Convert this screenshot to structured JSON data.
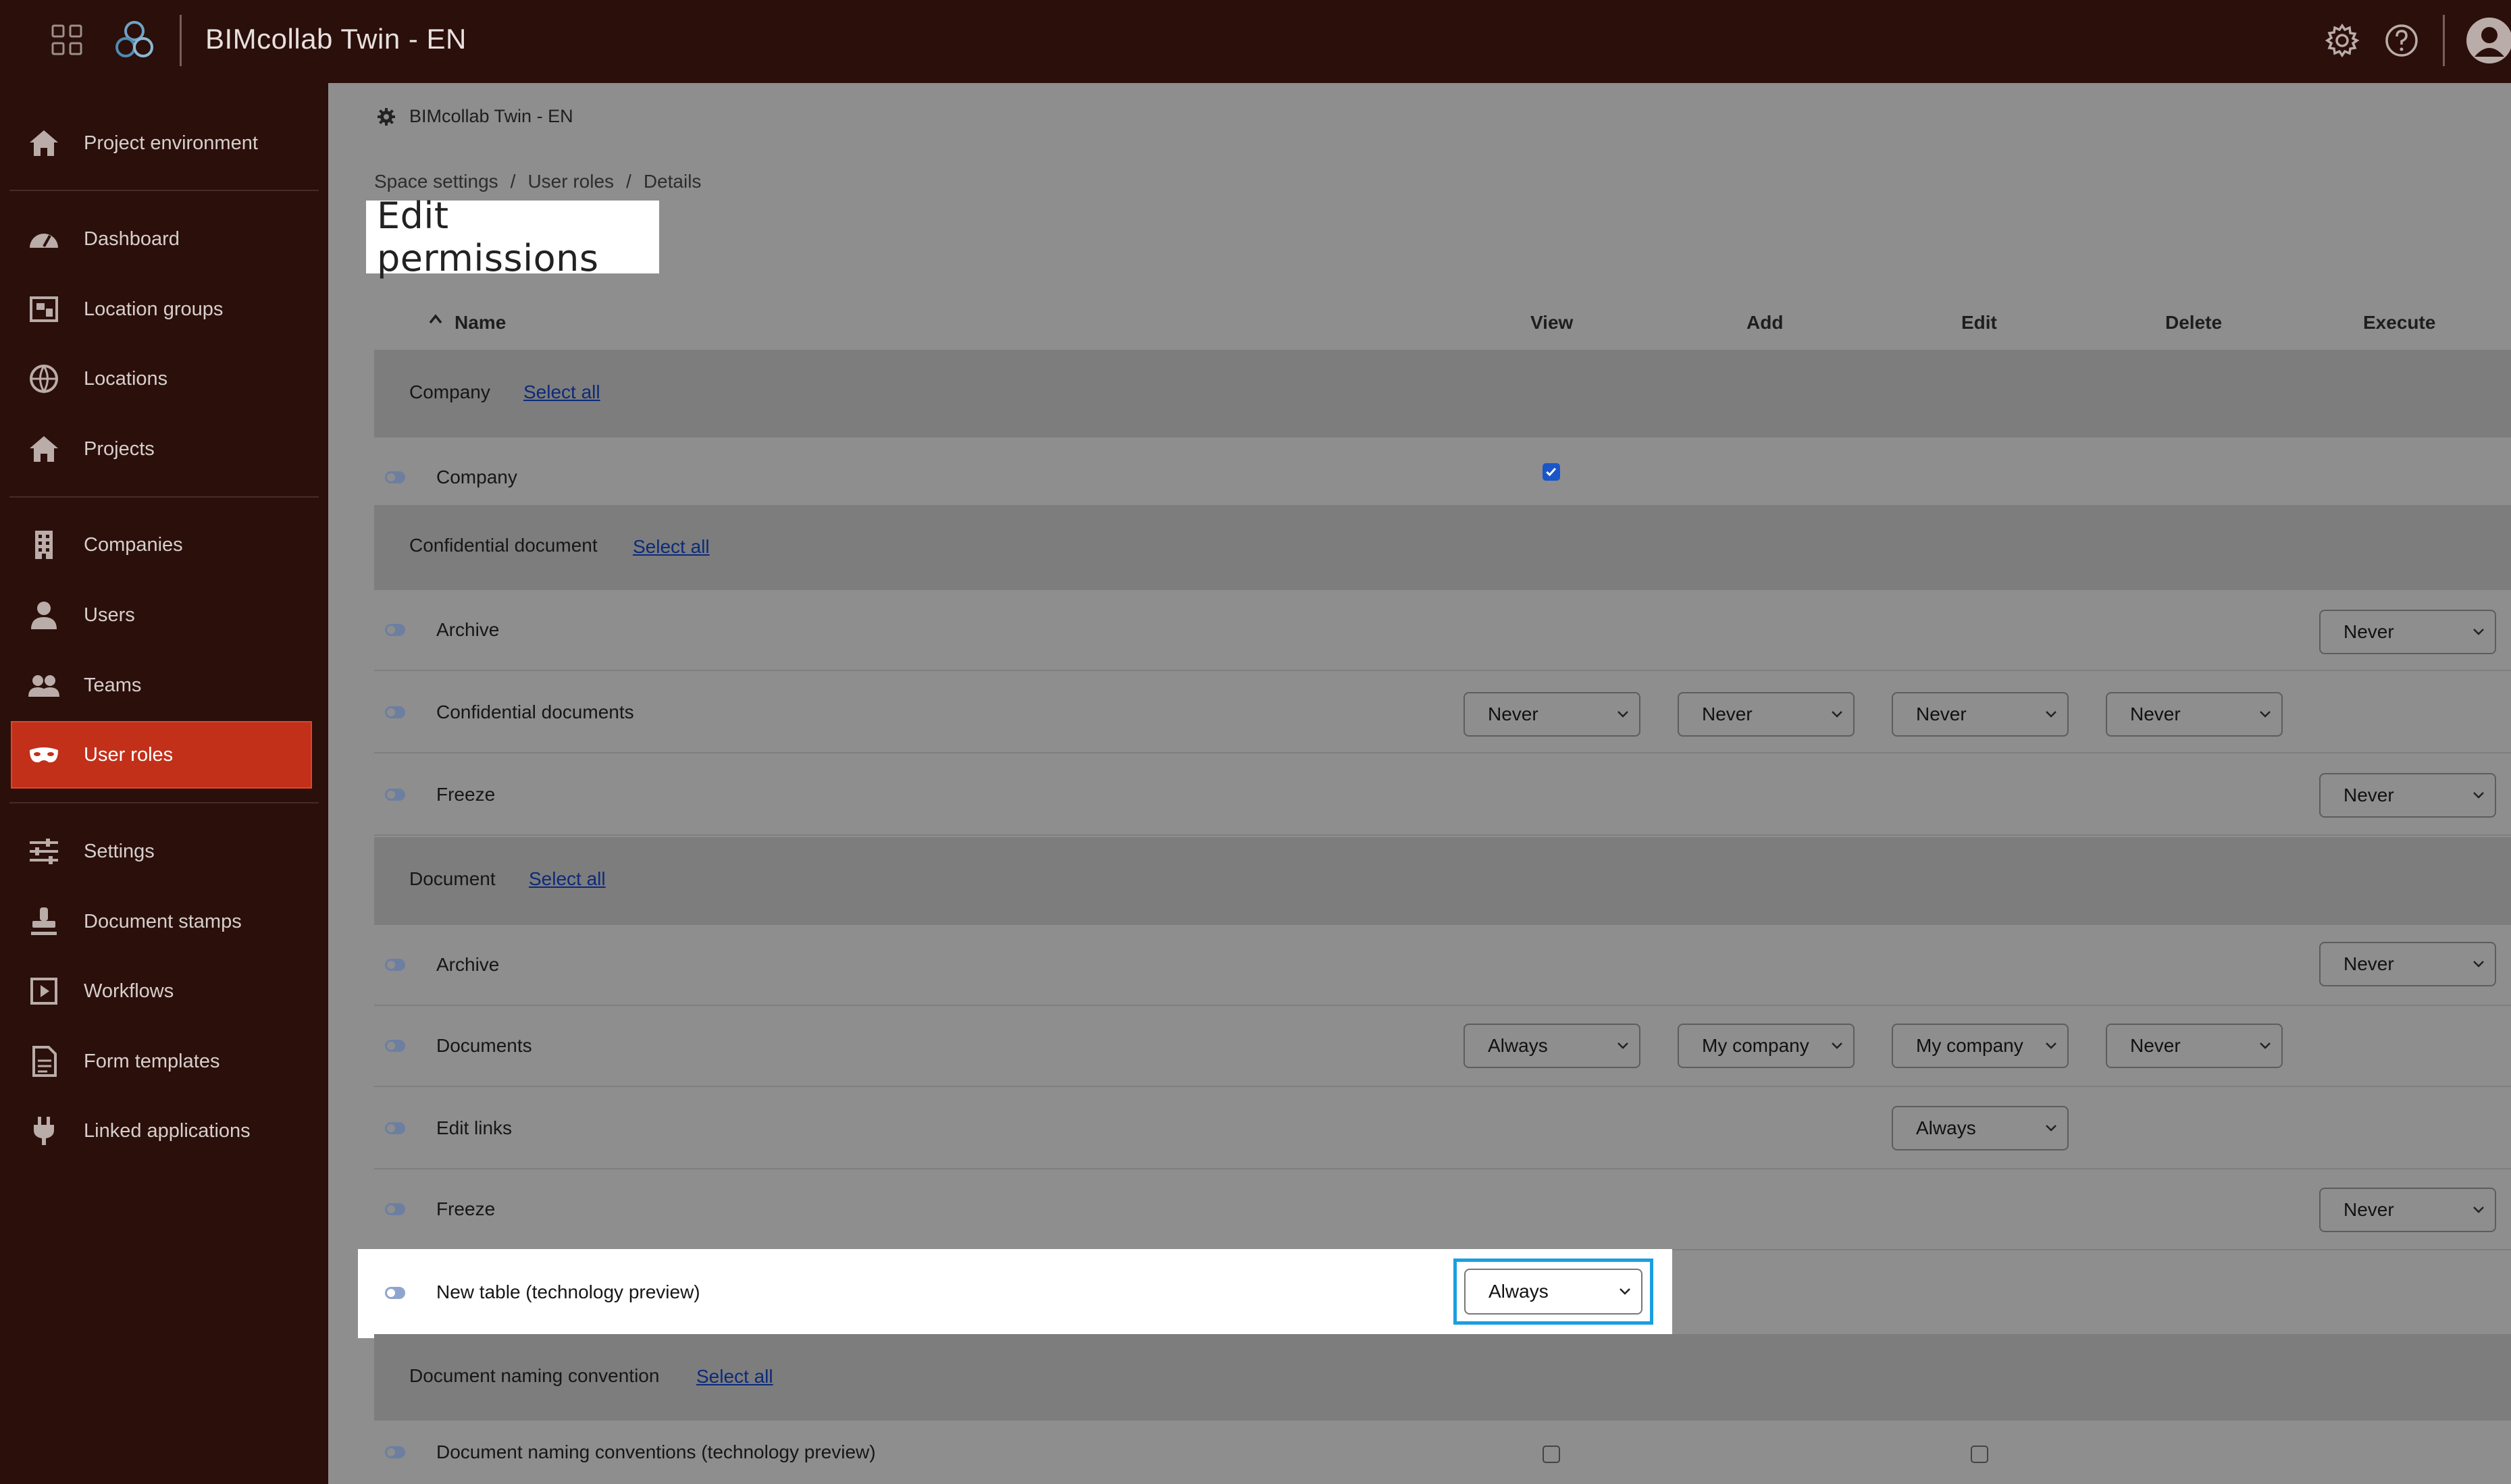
{
  "header": {
    "app_title": "BIMcollab Twin - EN",
    "icons": [
      "apps-grid-icon",
      "bimcollab-logo-icon",
      "settings-gear-icon",
      "help-icon",
      "user-avatar-icon"
    ]
  },
  "sidebar": {
    "items": [
      {
        "label": "Project environment",
        "icon": "home-icon"
      },
      {
        "label": "Dashboard",
        "icon": "dashboard-gauge-icon"
      },
      {
        "label": "Location groups",
        "icon": "location-groups-icon"
      },
      {
        "label": "Locations",
        "icon": "globe-icon"
      },
      {
        "label": "Projects",
        "icon": "home-icon"
      },
      {
        "label": "Companies",
        "icon": "building-icon"
      },
      {
        "label": "Users",
        "icon": "user-icon"
      },
      {
        "label": "Teams",
        "icon": "team-icon"
      },
      {
        "label": "User roles",
        "icon": "mask-icon",
        "active": true
      },
      {
        "label": "Settings",
        "icon": "sliders-icon"
      },
      {
        "label": "Document stamps",
        "icon": "stamp-icon"
      },
      {
        "label": "Workflows",
        "icon": "workflow-play-icon"
      },
      {
        "label": "Form templates",
        "icon": "form-document-icon"
      },
      {
        "label": "Linked applications",
        "icon": "plug-icon"
      }
    ]
  },
  "main": {
    "space_name": "BIMcollab Twin - EN",
    "breadcrumb": [
      "Space settings",
      "User roles",
      "Details"
    ],
    "breadcrumb_separator": "/",
    "page_title": "Edit permissions",
    "columns": {
      "name": "Name",
      "view": "View",
      "add": "Add",
      "edit": "Edit",
      "delete": "Delete",
      "execute": "Execute"
    },
    "select_all_label": "Select all",
    "groups": {
      "company": {
        "label": "Company",
        "rows": [
          {
            "label": "Company",
            "view_checked": true
          }
        ]
      },
      "confidential": {
        "label": "Confidential document",
        "rows": [
          {
            "label": "Archive",
            "execute": "Never"
          },
          {
            "label": "Confidential documents",
            "view": "Never",
            "add": "Never",
            "edit": "Never",
            "delete": "Never"
          },
          {
            "label": "Freeze",
            "execute": "Never"
          }
        ]
      },
      "document": {
        "label": "Document",
        "rows": [
          {
            "label": "Archive",
            "execute": "Never"
          },
          {
            "label": "Documents",
            "view": "Always",
            "add": "My company",
            "edit": "My company",
            "delete": "Never"
          },
          {
            "label": "Edit links",
            "edit": "Always"
          },
          {
            "label": "Freeze",
            "execute": "Never"
          },
          {
            "label": "New table (technology preview)",
            "view": "Always",
            "highlighted": true
          }
        ]
      },
      "naming": {
        "label": "Document naming convention",
        "rows": [
          {
            "label": "Document naming conventions (technology preview)",
            "view_checked": false,
            "edit_checked": false
          }
        ]
      }
    }
  },
  "colors": {
    "topbar": "#2b0f0a",
    "sidebar": "#2b0f0a",
    "active_nav": "#c2301a",
    "overlay_bg": "#8e8e8e",
    "highlight_frame": "#1a9fe0",
    "link": "#0c2a7a",
    "checkbox_on": "#1a56c9"
  }
}
